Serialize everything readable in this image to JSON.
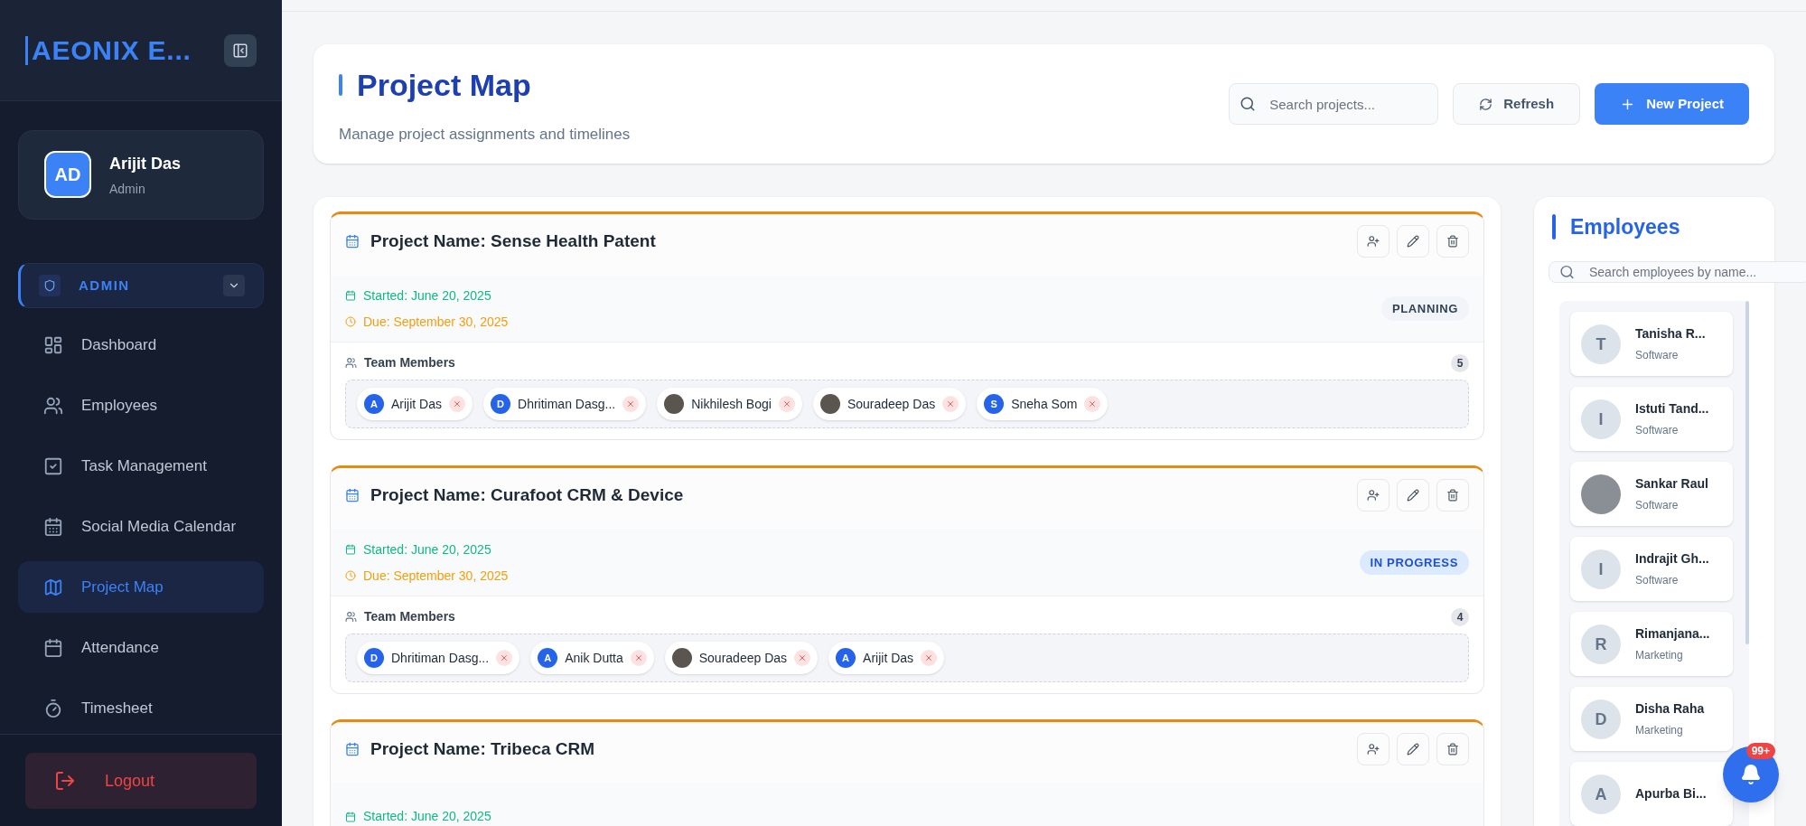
{
  "sidebar": {
    "logo": "AEONIX E...",
    "user": {
      "initials": "AD",
      "name": "Arijit Das",
      "role": "Admin"
    },
    "section": {
      "label": "ADMIN",
      "expanded": true
    },
    "items": [
      {
        "label": "Dashboard",
        "selected": false
      },
      {
        "label": "Employees",
        "selected": false
      },
      {
        "label": "Task Management",
        "selected": false
      },
      {
        "label": "Social Media Calendar",
        "selected": false
      },
      {
        "label": "Project Map",
        "selected": true
      },
      {
        "label": "Attendance",
        "selected": false
      },
      {
        "label": "Timesheet",
        "selected": false
      }
    ],
    "logout": "Logout"
  },
  "header": {
    "title": "Project Map",
    "subtitle": "Manage project assignments and timelines",
    "search": {
      "placeholder": "Search projects..."
    },
    "refresh": "Refresh",
    "new_project": "New Project"
  },
  "projects": [
    {
      "name": "Project Name: Sense Health Patent",
      "started": "Started: June 20, 2025",
      "due": "Due: September 30, 2025",
      "status": "PLANNING",
      "kind": "planning",
      "members_label": "Team Members",
      "count": "5",
      "members": [
        {
          "name": "Arijit Das",
          "kind": "initial",
          "initial": "A"
        },
        {
          "name": "Dhritiman Dasg...",
          "kind": "initial",
          "initial": "D"
        },
        {
          "name": "Nikhilesh Bogi",
          "kind": "photo"
        },
        {
          "name": "Souradeep Das",
          "kind": "photo"
        },
        {
          "name": "Sneha Som",
          "kind": "initial",
          "initial": "S"
        }
      ]
    },
    {
      "name": "Project Name: Curafoot CRM & Device",
      "started": "Started: June 20, 2025",
      "due": "Due: September 30, 2025",
      "status": "IN PROGRESS",
      "kind": "in_progress",
      "members_label": "Team Members",
      "count": "4",
      "members": [
        {
          "name": "Dhritiman Dasg...",
          "kind": "initial",
          "initial": "D"
        },
        {
          "name": "Anik Dutta",
          "kind": "initial",
          "initial": "A"
        },
        {
          "name": "Souradeep Das",
          "kind": "photo"
        },
        {
          "name": "Arijit Das",
          "kind": "initial",
          "initial": "A"
        }
      ]
    },
    {
      "name": "Project Name: Tribeca CRM",
      "started": "Started: June 20, 2025"
    }
  ],
  "employees": {
    "title": "Employees",
    "search": {
      "placeholder": "Search employees by name..."
    },
    "list": [
      {
        "name": "Tanisha R...",
        "dept": "Software",
        "kind": "initial",
        "initial": "T"
      },
      {
        "name": "Istuti Tand...",
        "dept": "Software",
        "kind": "initial",
        "initial": "I"
      },
      {
        "name": "Sankar Raul",
        "dept": "Software",
        "kind": "photo"
      },
      {
        "name": "Indrajit Gh...",
        "dept": "Software",
        "kind": "initial",
        "initial": "I"
      },
      {
        "name": "Rimanjana...",
        "dept": "Marketing",
        "kind": "initial",
        "initial": "R"
      },
      {
        "name": "Disha Raha",
        "dept": "Marketing",
        "kind": "initial",
        "initial": "D"
      },
      {
        "name": "Apurba Bi...",
        "kind": "initial",
        "initial": "A"
      }
    ]
  },
  "notifications": {
    "badge": "99+"
  }
}
